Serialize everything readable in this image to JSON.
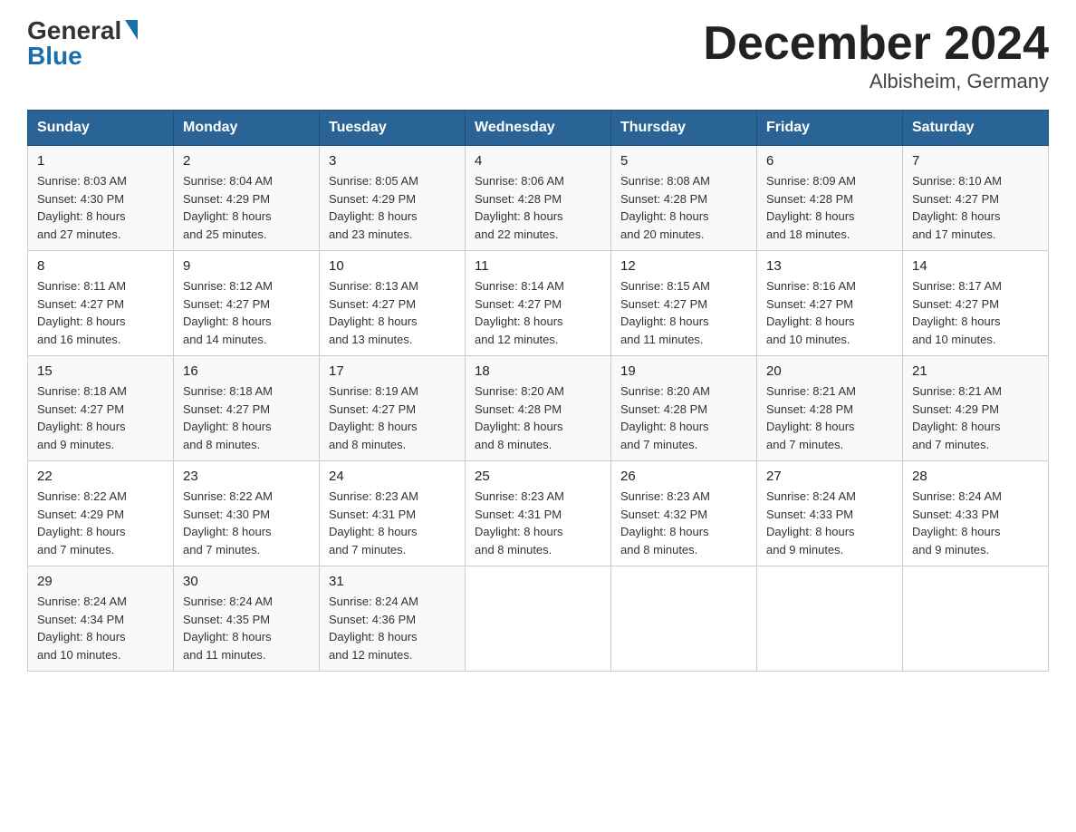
{
  "header": {
    "logo_general": "General",
    "logo_blue": "Blue",
    "month_title": "December 2024",
    "location": "Albisheim, Germany"
  },
  "days_of_week": [
    "Sunday",
    "Monday",
    "Tuesday",
    "Wednesday",
    "Thursday",
    "Friday",
    "Saturday"
  ],
  "weeks": [
    [
      {
        "day": "1",
        "sunrise": "8:03 AM",
        "sunset": "4:30 PM",
        "daylight": "8 hours and 27 minutes."
      },
      {
        "day": "2",
        "sunrise": "8:04 AM",
        "sunset": "4:29 PM",
        "daylight": "8 hours and 25 minutes."
      },
      {
        "day": "3",
        "sunrise": "8:05 AM",
        "sunset": "4:29 PM",
        "daylight": "8 hours and 23 minutes."
      },
      {
        "day": "4",
        "sunrise": "8:06 AM",
        "sunset": "4:28 PM",
        "daylight": "8 hours and 22 minutes."
      },
      {
        "day": "5",
        "sunrise": "8:08 AM",
        "sunset": "4:28 PM",
        "daylight": "8 hours and 20 minutes."
      },
      {
        "day": "6",
        "sunrise": "8:09 AM",
        "sunset": "4:28 PM",
        "daylight": "8 hours and 18 minutes."
      },
      {
        "day": "7",
        "sunrise": "8:10 AM",
        "sunset": "4:27 PM",
        "daylight": "8 hours and 17 minutes."
      }
    ],
    [
      {
        "day": "8",
        "sunrise": "8:11 AM",
        "sunset": "4:27 PM",
        "daylight": "8 hours and 16 minutes."
      },
      {
        "day": "9",
        "sunrise": "8:12 AM",
        "sunset": "4:27 PM",
        "daylight": "8 hours and 14 minutes."
      },
      {
        "day": "10",
        "sunrise": "8:13 AM",
        "sunset": "4:27 PM",
        "daylight": "8 hours and 13 minutes."
      },
      {
        "day": "11",
        "sunrise": "8:14 AM",
        "sunset": "4:27 PM",
        "daylight": "8 hours and 12 minutes."
      },
      {
        "day": "12",
        "sunrise": "8:15 AM",
        "sunset": "4:27 PM",
        "daylight": "8 hours and 11 minutes."
      },
      {
        "day": "13",
        "sunrise": "8:16 AM",
        "sunset": "4:27 PM",
        "daylight": "8 hours and 10 minutes."
      },
      {
        "day": "14",
        "sunrise": "8:17 AM",
        "sunset": "4:27 PM",
        "daylight": "8 hours and 10 minutes."
      }
    ],
    [
      {
        "day": "15",
        "sunrise": "8:18 AM",
        "sunset": "4:27 PM",
        "daylight": "8 hours and 9 minutes."
      },
      {
        "day": "16",
        "sunrise": "8:18 AM",
        "sunset": "4:27 PM",
        "daylight": "8 hours and 8 minutes."
      },
      {
        "day": "17",
        "sunrise": "8:19 AM",
        "sunset": "4:27 PM",
        "daylight": "8 hours and 8 minutes."
      },
      {
        "day": "18",
        "sunrise": "8:20 AM",
        "sunset": "4:28 PM",
        "daylight": "8 hours and 8 minutes."
      },
      {
        "day": "19",
        "sunrise": "8:20 AM",
        "sunset": "4:28 PM",
        "daylight": "8 hours and 7 minutes."
      },
      {
        "day": "20",
        "sunrise": "8:21 AM",
        "sunset": "4:28 PM",
        "daylight": "8 hours and 7 minutes."
      },
      {
        "day": "21",
        "sunrise": "8:21 AM",
        "sunset": "4:29 PM",
        "daylight": "8 hours and 7 minutes."
      }
    ],
    [
      {
        "day": "22",
        "sunrise": "8:22 AM",
        "sunset": "4:29 PM",
        "daylight": "8 hours and 7 minutes."
      },
      {
        "day": "23",
        "sunrise": "8:22 AM",
        "sunset": "4:30 PM",
        "daylight": "8 hours and 7 minutes."
      },
      {
        "day": "24",
        "sunrise": "8:23 AM",
        "sunset": "4:31 PM",
        "daylight": "8 hours and 7 minutes."
      },
      {
        "day": "25",
        "sunrise": "8:23 AM",
        "sunset": "4:31 PM",
        "daylight": "8 hours and 8 minutes."
      },
      {
        "day": "26",
        "sunrise": "8:23 AM",
        "sunset": "4:32 PM",
        "daylight": "8 hours and 8 minutes."
      },
      {
        "day": "27",
        "sunrise": "8:24 AM",
        "sunset": "4:33 PM",
        "daylight": "8 hours and 9 minutes."
      },
      {
        "day": "28",
        "sunrise": "8:24 AM",
        "sunset": "4:33 PM",
        "daylight": "8 hours and 9 minutes."
      }
    ],
    [
      {
        "day": "29",
        "sunrise": "8:24 AM",
        "sunset": "4:34 PM",
        "daylight": "8 hours and 10 minutes."
      },
      {
        "day": "30",
        "sunrise": "8:24 AM",
        "sunset": "4:35 PM",
        "daylight": "8 hours and 11 minutes."
      },
      {
        "day": "31",
        "sunrise": "8:24 AM",
        "sunset": "4:36 PM",
        "daylight": "8 hours and 12 minutes."
      },
      null,
      null,
      null,
      null
    ]
  ],
  "labels": {
    "sunrise": "Sunrise:",
    "sunset": "Sunset:",
    "daylight": "Daylight:"
  }
}
